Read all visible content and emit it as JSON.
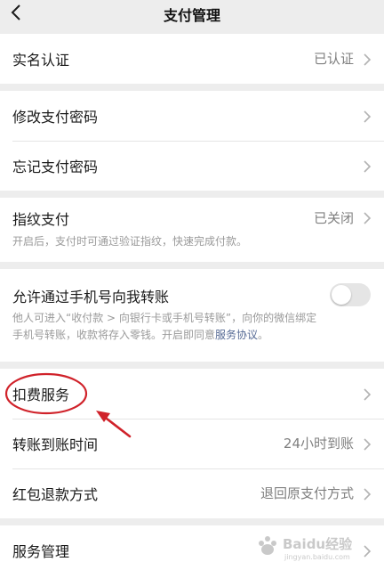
{
  "header": {
    "title": "支付管理",
    "back_icon": "chevron-left-icon"
  },
  "realname": {
    "label": "实名认证",
    "value": "已认证"
  },
  "change_password": {
    "label": "修改支付密码"
  },
  "forgot_password": {
    "label": "忘记支付密码"
  },
  "fingerprint": {
    "label": "指纹支付",
    "value": "已关闭",
    "description": "开启后，支付时可通过验证指纹，快速完成付款。"
  },
  "phone_transfer": {
    "label": "允许通过手机号向我转账",
    "toggle_on": false,
    "description_line1": "他人可进入“收付款 > 向银行卡或手机号转账”，向你的微信绑定",
    "description_line2_prefix": "手机号转账，收款将存入零钱。开启即同意",
    "description_link": "服务协议",
    "description_suffix": "。"
  },
  "deduction": {
    "label": "扣费服务"
  },
  "transfer_time": {
    "label": "转账到账时间",
    "value": "24小时到账"
  },
  "redpacket_refund": {
    "label": "红包退款方式",
    "value": "退回原支付方式"
  },
  "service_manage": {
    "label": "服务管理"
  },
  "colors": {
    "background": "#ededed",
    "annotation_red": "#d0222a",
    "link": "#576b95"
  },
  "watermark": {
    "text": "Baidu经验",
    "sub": "jingyan.baidu.com"
  }
}
